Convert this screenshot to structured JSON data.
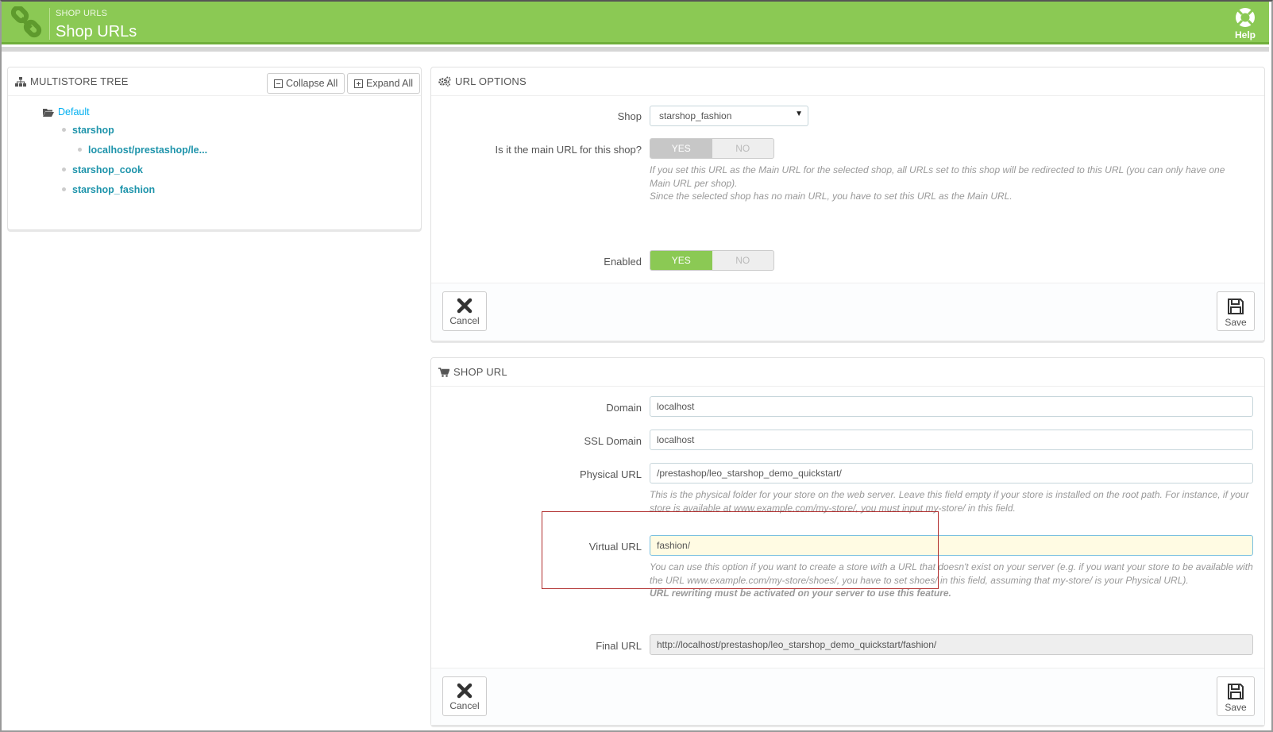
{
  "header": {
    "breadcrumb": "SHOP URLS",
    "title": "Shop URLs",
    "help_label": "Help"
  },
  "tree": {
    "title": "MULTISTORE TREE",
    "collapse_label": "Collapse All",
    "expand_label": "Expand All",
    "root": "Default",
    "nodes": [
      {
        "label": "starshop",
        "level": 1
      },
      {
        "label": "localhost/prestashop/le...",
        "level": 2
      },
      {
        "label": "starshop_cook",
        "level": 1
      },
      {
        "label": "starshop_fashion",
        "level": 1
      }
    ]
  },
  "url_options": {
    "title": "URL OPTIONS",
    "shop_label": "Shop",
    "shop_value": "starshop_fashion",
    "main_url_label": "Is it the main URL for this shop?",
    "main_url_help_1": "If you set this URL as the Main URL for the selected shop, all URLs set to this shop will be redirected to this URL (you can only have one Main URL per shop).",
    "main_url_help_2": "Since the selected shop has no main URL, you have to set this URL as the Main URL.",
    "enabled_label": "Enabled",
    "yes": "YES",
    "no": "NO",
    "cancel": "Cancel",
    "save": "Save"
  },
  "shop_url": {
    "title": "SHOP URL",
    "domain_label": "Domain",
    "domain_value": "localhost",
    "ssl_label": "SSL Domain",
    "ssl_value": "localhost",
    "physical_label": "Physical URL",
    "physical_value": "/prestashop/leo_starshop_demo_quickstart/",
    "physical_help": "This is the physical folder for your store on the web server. Leave this field empty if your store is installed on the root path. For instance, if your store is available at www.example.com/my-store/, you must input my-store/ in this field.",
    "virtual_label": "Virtual URL",
    "virtual_value": "fashion/",
    "virtual_help": "You can use this option if you want to create a store with a URL that doesn't exist on your server (e.g. if you want your store to be available with the URL www.example.com/my-store/shoes/, you have to set shoes/ in this field, assuming that my-store/ is your Physical URL).",
    "virtual_help_bold": "URL rewriting must be activated on your server to use this feature.",
    "final_label": "Final URL",
    "final_value": "http://localhost/prestashop/leo_starshop_demo_quickstart/fashion/",
    "cancel": "Cancel",
    "save": "Save"
  },
  "colors": {
    "header_green": "#8bc954",
    "tree_link": "#1e94ab",
    "highlight_box": "#b02b2b"
  }
}
